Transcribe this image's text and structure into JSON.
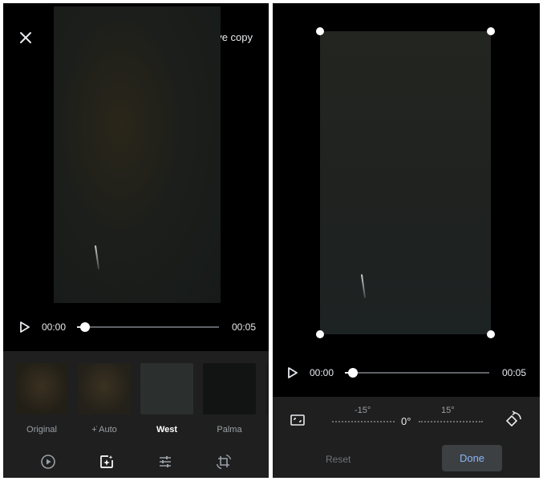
{
  "left": {
    "toolbar": {
      "close_icon": "close-icon",
      "save_copy_label": "Save copy"
    },
    "player": {
      "play_icon": "play-icon",
      "current_time": "00:00",
      "duration": "00:05",
      "progress_fraction": 0.0
    },
    "filters": [
      {
        "label": "Original",
        "selected": false
      },
      {
        "label": "Auto",
        "prefix_icon": "sparkle-icon",
        "selected": false
      },
      {
        "label": "West",
        "selected": true
      },
      {
        "label": "Palma",
        "selected": false
      }
    ],
    "tools": [
      {
        "name": "video-tool",
        "icon": "play-circle-icon"
      },
      {
        "name": "filters-tool",
        "icon": "photo-filter-icon",
        "active": true
      },
      {
        "name": "adjust-tool",
        "icon": "sliders-icon"
      },
      {
        "name": "crop-rotate-tool",
        "icon": "crop-rotate-icon"
      }
    ]
  },
  "right": {
    "player": {
      "play_icon": "play-icon",
      "current_time": "00:00",
      "duration": "00:05",
      "progress_fraction": 0.0
    },
    "crop": {
      "aspect_icon": "aspect-ratio-icon",
      "rotate_icon": "rotate-icon",
      "dial": {
        "left_mark": "-15°",
        "center_value": "0°",
        "right_mark": "15°"
      }
    },
    "actions": {
      "reset_label": "Reset",
      "done_label": "Done"
    }
  },
  "colors": {
    "background": "#000000",
    "panel_bar": "#1f1f1f",
    "accent_blue": "#8ab4f8",
    "done_bg": "#3c4043"
  }
}
